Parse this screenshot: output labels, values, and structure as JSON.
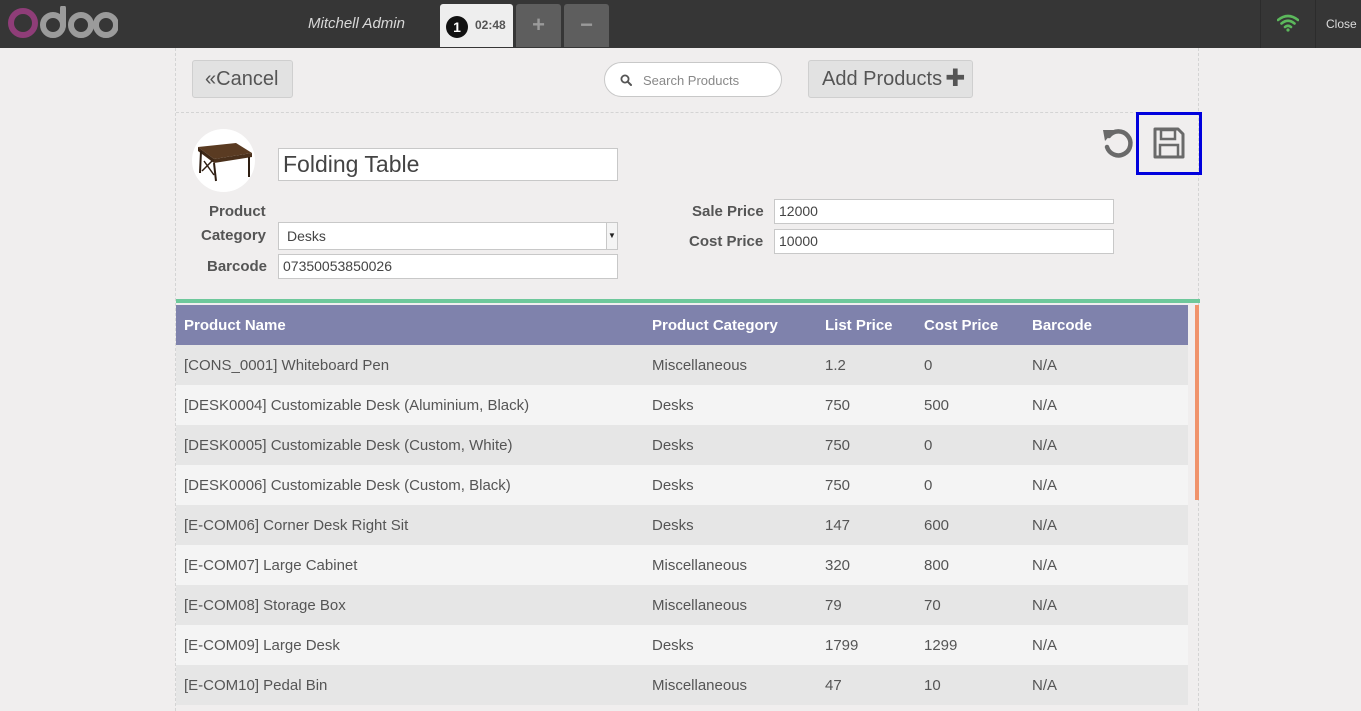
{
  "topbar": {
    "user_name": "Mitchell Admin",
    "order_number": "1",
    "order_time": "02:48",
    "add_order_label": "+",
    "remove_order_label": "−",
    "close_label": "Close",
    "wifi_color": "#5cb85c"
  },
  "toolbar": {
    "cancel_label": "Cancel",
    "search_placeholder": "Search Products",
    "add_products_label": "Add Products"
  },
  "product": {
    "name": "Folding Table",
    "category_label_line1": "Product",
    "category_label_line2": "Category",
    "category_value": "Desks",
    "barcode_label": "Barcode",
    "barcode_value": "07350053850026",
    "sale_price_label": "Sale Price",
    "sale_price_value": "12000",
    "cost_price_label": "Cost Price",
    "cost_price_value": "10000"
  },
  "table": {
    "headers": [
      "Product Name",
      "Product Category",
      "List Price",
      "Cost Price",
      "Barcode"
    ],
    "rows": [
      [
        "[CONS_0001] Whiteboard Pen",
        "Miscellaneous",
        "1.2",
        "0",
        "N/A"
      ],
      [
        "[DESK0004] Customizable Desk (Aluminium, Black)",
        "Desks",
        "750",
        "500",
        "N/A"
      ],
      [
        "[DESK0005] Customizable Desk (Custom, White)",
        "Desks",
        "750",
        "0",
        "N/A"
      ],
      [
        "[DESK0006] Customizable Desk (Custom, Black)",
        "Desks",
        "750",
        "0",
        "N/A"
      ],
      [
        "[E-COM06] Corner Desk Right Sit",
        "Desks",
        "147",
        "600",
        "N/A"
      ],
      [
        "[E-COM07] Large Cabinet",
        "Miscellaneous",
        "320",
        "800",
        "N/A"
      ],
      [
        "[E-COM08] Storage Box",
        "Miscellaneous",
        "79",
        "70",
        "N/A"
      ],
      [
        "[E-COM09] Large Desk",
        "Desks",
        "1799",
        "1299",
        "N/A"
      ],
      [
        "[E-COM10] Pedal Bin",
        "Miscellaneous",
        "47",
        "10",
        "N/A"
      ]
    ]
  },
  "colors": {
    "topbar": "#363636",
    "table_header": "#7f82ac",
    "accent_green": "#6ec89b",
    "accent_orange": "#f0936b",
    "highlight_border": "#0000dd"
  }
}
